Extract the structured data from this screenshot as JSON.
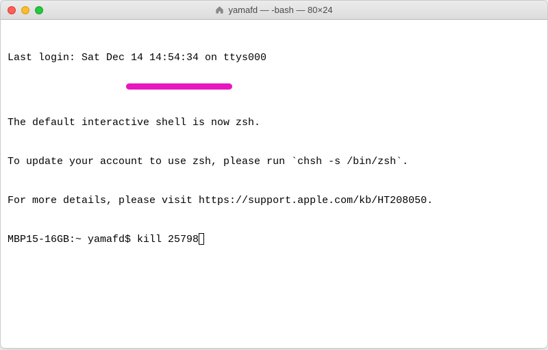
{
  "window": {
    "title": "yamafd — -bash — 80×24"
  },
  "terminal": {
    "lines": [
      "Last login: Sat Dec 14 14:54:34 on ttys000",
      "",
      "The default interactive shell is now zsh.",
      "To update your account to use zsh, please run `chsh -s /bin/zsh`.",
      "For more details, please visit https://support.apple.com/kb/HT208050."
    ],
    "prompt": "MBP15-16GB:~ yamafd$ ",
    "command": "kill 25798"
  },
  "annotation": {
    "color": "#e815c0"
  }
}
